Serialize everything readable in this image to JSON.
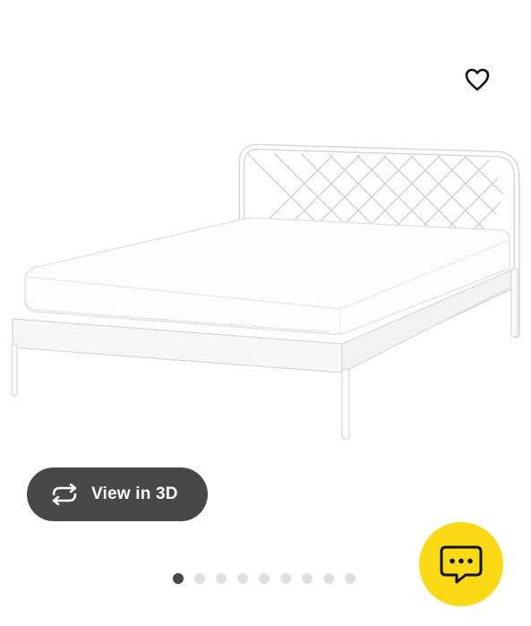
{
  "favorite": {
    "icon": "heart-outline-icon"
  },
  "product": {
    "image": "white-metal-bed-frame-photo"
  },
  "view3d": {
    "label": "View in 3D",
    "icon": "rotate-arrows-icon"
  },
  "carousel": {
    "total": 9,
    "active_index": 0
  },
  "chat": {
    "icon": "chat-bubble-icon"
  },
  "colors": {
    "button_dark": "#484848",
    "chat_yellow": "#fbd914",
    "dot_inactive": "#dfdfdf"
  }
}
